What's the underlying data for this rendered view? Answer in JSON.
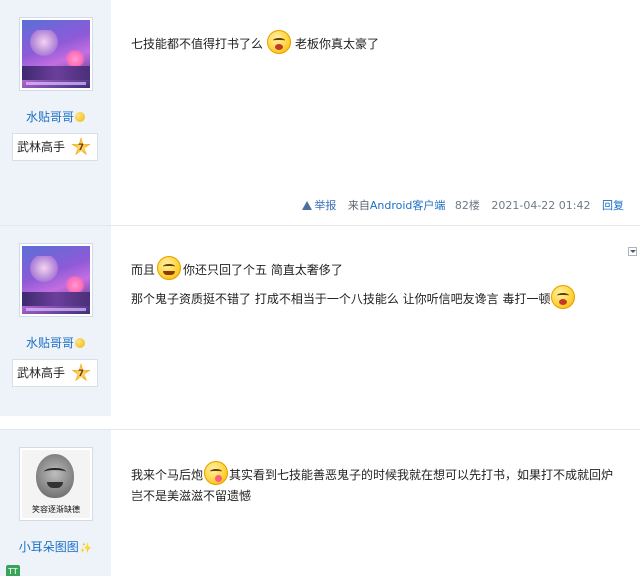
{
  "posts": [
    {
      "username": "水贴哥哥",
      "rank": "武林高手",
      "rank_level": "7",
      "text_before": "七技能都不值得打书了么",
      "emoji": "surprised-emoji",
      "text_after": "老板你真太豪了",
      "meta": {
        "report": "举报",
        "client_prefix": "来自",
        "client": "Android客户端",
        "floor": "82楼",
        "time": "2021-04-22 01:42",
        "reply": "回复"
      }
    },
    {
      "username": "水贴哥哥",
      "rank": "武林高手",
      "rank_level": "7",
      "line1_before": "而且",
      "line1_emoji": "grin-emoji",
      "line1_after": "你还只回了个五 简直太奢侈了",
      "line2_before": "那个鬼子资质挺不错了 打成不相当于一个八技能么 让你听信吧友谗言 毒打一顿",
      "line2_emoji": "surprised-emoji"
    },
    {
      "username": "小耳朵图图",
      "avatar_caption": "笑容逐渐缺德",
      "line1_before": "我来个马后炮",
      "line1_emoji": "tongue-emoji",
      "line1_after": "其实看到七技能善恶鬼子的时候我就在想可以先打书，如果打不成就回炉",
      "line2": "岂不是美滋滋不留遗憾"
    }
  ],
  "colors": {
    "sidebar_bg": "#eef3fa",
    "username": "#1b6fc4",
    "meta_text": "#6f7a87",
    "link": "#1b6fc4"
  }
}
